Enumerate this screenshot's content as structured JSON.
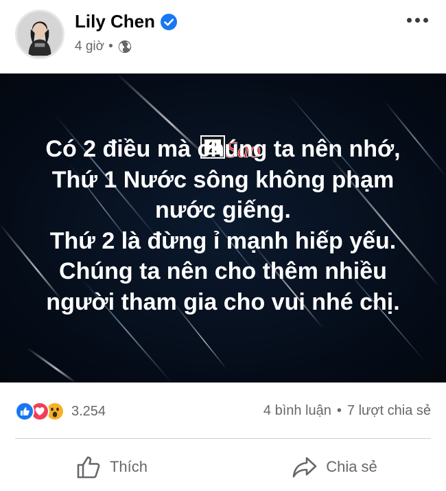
{
  "post": {
    "author": "Lily Chen",
    "time": "4 giờ",
    "meta_dot": "•",
    "privacy_icon": "globe-icon",
    "verified_color": "#1877f2"
  },
  "image": {
    "watermark": {
      "number": "2",
      "text": "Sao"
    },
    "lines": [
      "Có 2 điều mà chúng ta nên nhớ,",
      "Thứ 1 Nước sông không phạm",
      "nước giếng.",
      "Thứ 2 là đừng ỉ mạnh hiếp yếu.",
      "Chúng ta nên cho thêm nhiều",
      "người tham gia cho vui nhé chị."
    ]
  },
  "stats": {
    "reaction_count": "3.254",
    "reactions": [
      "like-icon",
      "love-icon",
      "wow-icon"
    ],
    "comments": "4 bình luận",
    "dot": "•",
    "shares": "7 lượt chia sẻ"
  },
  "actions": {
    "like_label": "Thích",
    "share_label": "Chia sẻ"
  },
  "colors": {
    "accent": "#1877f2",
    "secondary_text": "#65676b",
    "image_bg": "#07101e",
    "watermark_red": "#e8242a"
  }
}
